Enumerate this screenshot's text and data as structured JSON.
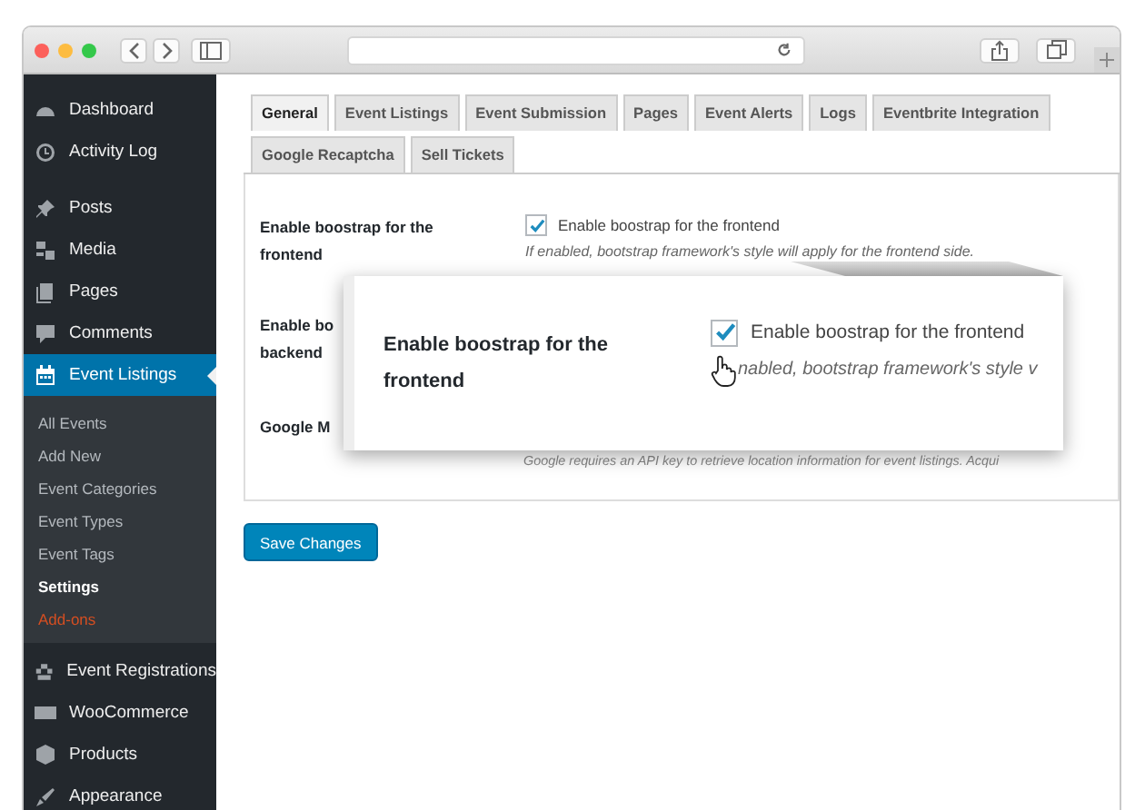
{
  "sidebar": {
    "items": [
      {
        "label": "Dashboard",
        "selected": false
      },
      {
        "label": "Activity Log",
        "selected": false
      },
      {
        "label": "Posts",
        "selected": false
      },
      {
        "label": "Media",
        "selected": false
      },
      {
        "label": "Pages",
        "selected": false
      },
      {
        "label": "Comments",
        "selected": false
      },
      {
        "label": "Event Listings",
        "selected": true,
        "children": [
          {
            "label": "All Events",
            "kind": "link",
            "selected": false
          },
          {
            "label": "Add New",
            "kind": "link",
            "selected": false
          },
          {
            "label": "Event Categories",
            "kind": "link",
            "selected": false
          },
          {
            "label": "Event Types",
            "kind": "link",
            "selected": false
          },
          {
            "label": "Event Tags",
            "kind": "link",
            "selected": false
          },
          {
            "label": "Settings",
            "kind": "link",
            "selected": true
          },
          {
            "label": "Add-ons",
            "kind": "addon",
            "selected": false
          }
        ]
      },
      {
        "label": "Event Registrations",
        "selected": false
      },
      {
        "label": "WooCommerce",
        "selected": false
      },
      {
        "label": "Products",
        "selected": false
      },
      {
        "label": "Appearance",
        "selected": false
      }
    ]
  },
  "tabs": [
    {
      "label": "General",
      "selected": true
    },
    {
      "label": "Event Listings",
      "selected": false
    },
    {
      "label": "Event Submission",
      "selected": false
    },
    {
      "label": "Pages",
      "selected": false
    },
    {
      "label": "Event Alerts",
      "selected": false
    },
    {
      "label": "Logs",
      "selected": false
    },
    {
      "label": "Eventbrite Integration",
      "selected": false
    },
    {
      "label": "Google Recaptcha",
      "selected": false
    },
    {
      "label": "Sell Tickets",
      "selected": false
    }
  ],
  "settings": {
    "rows": [
      {
        "label": "Enable boostrap for the frontend",
        "checkbox_label": "Enable boostrap for the frontend",
        "checked": true,
        "description": "If enabled, bootstrap framework's style will apply for the frontend side."
      },
      {
        "label_lines": [
          "Enable bo",
          "backend"
        ]
      },
      {
        "label_lines": [
          "Google M"
        ],
        "description": "Google requires an API key to retrieve location information for event listings. Acqui"
      }
    ]
  },
  "callout": {
    "label": "Enable boostrap for the frontend",
    "checkbox_label": "Enable boostrap for the frontend",
    "checked": true,
    "description": "nabled, bootstrap framework's style v"
  },
  "save_button": "Save Changes"
}
